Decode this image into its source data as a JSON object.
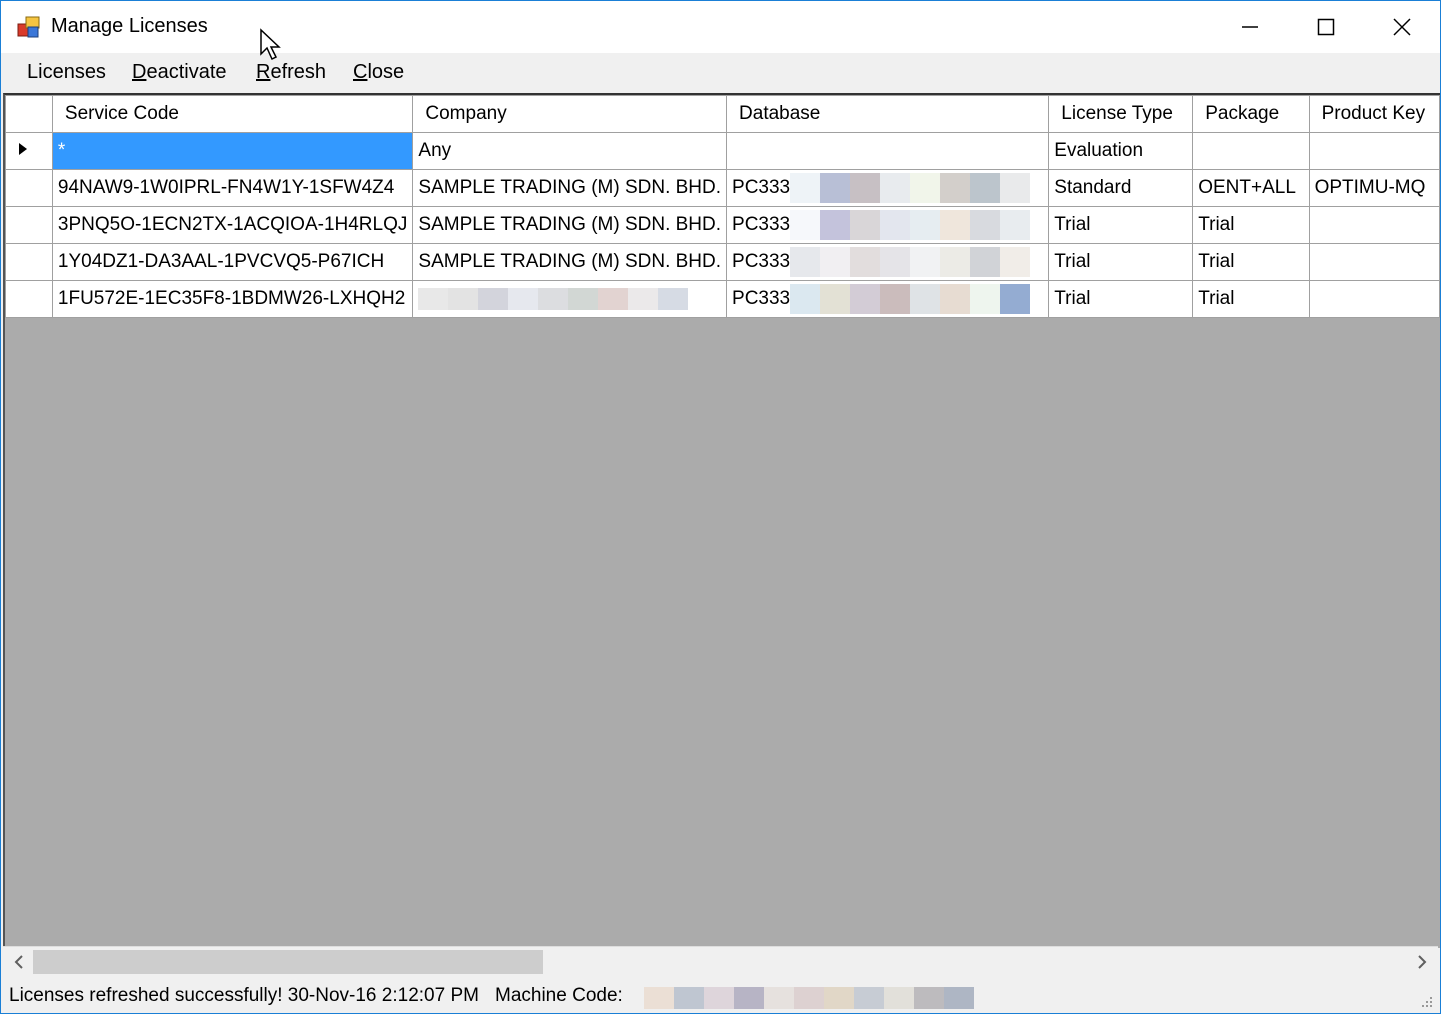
{
  "window": {
    "title": "Manage Licenses",
    "controls": [
      "minimize",
      "maximize",
      "close"
    ]
  },
  "menu": {
    "licenses": "Licenses",
    "deactivate_first": "D",
    "deactivate_rest": "eactivate",
    "refresh_first": "R",
    "refresh_rest": "efresh",
    "close_first": "C",
    "close_rest": "lose"
  },
  "grid": {
    "columns": [
      "Service Code",
      "Company",
      "Database",
      "License Type",
      "Package",
      "Product Key"
    ],
    "rows": [
      {
        "service_code": "*",
        "company": "Any",
        "database": "",
        "license_type": "Evaluation",
        "package": "",
        "product_key": ""
      },
      {
        "service_code": "94NAW9-1W0IPRL-FN4W1Y-1SFW4Z4",
        "company": "SAMPLE TRADING (M) SDN. BHD.",
        "database": "PC333",
        "license_type": "Standard",
        "package": "OENT+ALL",
        "product_key": "OPTIMU-MQ"
      },
      {
        "service_code": "3PNQ5O-1ECN2TX-1ACQIOA-1H4RLQJ",
        "company": "SAMPLE TRADING (M) SDN. BHD.",
        "database": "PC333",
        "license_type": "Trial",
        "package": "Trial",
        "product_key": ""
      },
      {
        "service_code": "1Y04DZ1-DA3AAL-1PVCVQ5-P67ICH",
        "company": "SAMPLE TRADING (M) SDN. BHD.",
        "database": "PC333",
        "license_type": "Trial",
        "package": "Trial",
        "product_key": ""
      },
      {
        "service_code": "1FU572E-1EC35F8-1BDMW26-LXHQH2",
        "company": "",
        "database": "PC333",
        "license_type": "Trial",
        "package": "Trial",
        "product_key": ""
      }
    ]
  },
  "status": {
    "message": "Licenses refreshed successfully! 30-Nov-16 2:12:07 PM",
    "machine_code_label": "Machine Code:"
  },
  "colors": {
    "selection": "#3399ff",
    "empty_area": "#ababab",
    "window_border": "#1a7fd6"
  }
}
